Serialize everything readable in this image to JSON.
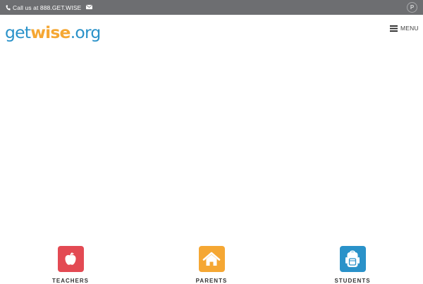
{
  "topbar": {
    "phone_text": "Call us at 888.GET.WISE",
    "phone_icon": "phone-icon",
    "email_icon": "envelope-icon",
    "social_icon": "pinterest-icon",
    "social_glyph": "P",
    "background": "#6d6e71"
  },
  "header": {
    "logo": {
      "part1": "get",
      "part2": "wise",
      "part3": ".org",
      "blue": "#2a92c9",
      "orange": "#f5a733"
    },
    "menu_label": "MENU",
    "menu_icon": "hamburger-icon"
  },
  "audience": [
    {
      "label": "TEACHERS",
      "icon": "apple-icon",
      "color": "#e34a53"
    },
    {
      "label": "PARENTS",
      "icon": "house-icon",
      "color": "#f5a733"
    },
    {
      "label": "STUDENTS",
      "icon": "backpack-icon",
      "color": "#2a92c9"
    }
  ]
}
